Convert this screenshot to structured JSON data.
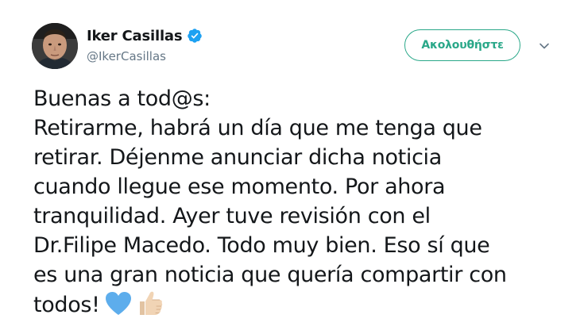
{
  "author": {
    "display_name": "Iker Casillas",
    "handle": "@IkerCasillas",
    "verified": true,
    "avatar": "profile-photo"
  },
  "actions": {
    "follow_label": "Ακολουθήστε",
    "more_icon": "chevron-down-icon"
  },
  "tweet": {
    "lines": [
      "Buenas a tod@s:",
      "Retirarme, habrá un día que me tenga que",
      "retirar. Déjenme anunciar dicha noticia",
      "cuando llegue ese momento. Por ahora",
      "tranquilidad. Ayer tuve revisión con el",
      "Dr.Filipe Macedo. Todo muy bien. Eso sí que",
      "es una gran noticia que quería compartir con",
      "todos!"
    ],
    "emojis": [
      "blue-heart-icon",
      "thumbs-up-icon"
    ]
  },
  "colors": {
    "accent": "#2aa889",
    "verified_blue": "#1da1f2",
    "text": "#14171a",
    "secondary": "#657786"
  }
}
